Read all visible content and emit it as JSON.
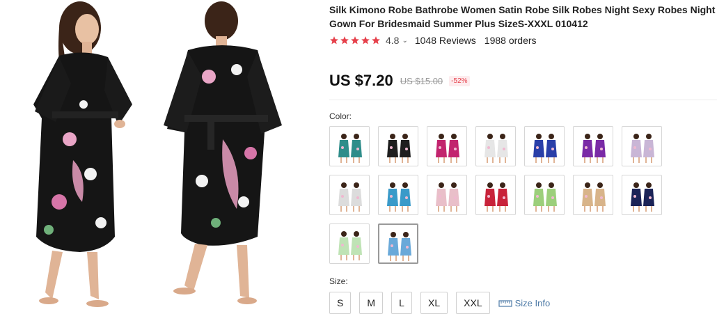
{
  "product": {
    "title": "Silk Kimono Robe Bathrobe Women Satin Robe Silk Robes Night Sexy Robes Night Gown For Bridesmaid Summer Plus SizeS-XXXL 010412",
    "rating": "4.8",
    "rating_stars": 5,
    "reviews": "1048 Reviews",
    "orders": "1988 orders",
    "price": "US $7.20",
    "old_price": "US $15.00",
    "discount": "-52%"
  },
  "colors": {
    "accent": "#e6404b",
    "star_color": "#e6404b",
    "link_color": "#4d7aa6"
  },
  "color_section": {
    "label": "Color:",
    "swatches": [
      {
        "name": "teal",
        "color": "#2f8d8a"
      },
      {
        "name": "black",
        "color": "#1e1e1e"
      },
      {
        "name": "magenta",
        "color": "#c2246e"
      },
      {
        "name": "white",
        "color": "#e6e6e6"
      },
      {
        "name": "royal-blue",
        "color": "#2a3fa8"
      },
      {
        "name": "purple",
        "color": "#7a2aa6"
      },
      {
        "name": "lilac",
        "color": "#c9b6d6"
      },
      {
        "name": "white-floral",
        "color": "#dcdcdc"
      },
      {
        "name": "light-blue",
        "color": "#3a9ac9"
      },
      {
        "name": "pink",
        "color": "#e9bfc9"
      },
      {
        "name": "red",
        "color": "#c8233a"
      },
      {
        "name": "light-green",
        "color": "#9ccf7b"
      },
      {
        "name": "champagne",
        "color": "#d8b48a"
      },
      {
        "name": "navy",
        "color": "#1b2357"
      },
      {
        "name": "mint",
        "color": "#bfe3b5"
      },
      {
        "name": "sky-blue-photo",
        "color": "#6aa9d9"
      }
    ]
  },
  "size_section": {
    "label": "Size:",
    "sizes": [
      "S",
      "M",
      "L",
      "XL",
      "XXL"
    ],
    "size_info_label": "Size Info"
  }
}
